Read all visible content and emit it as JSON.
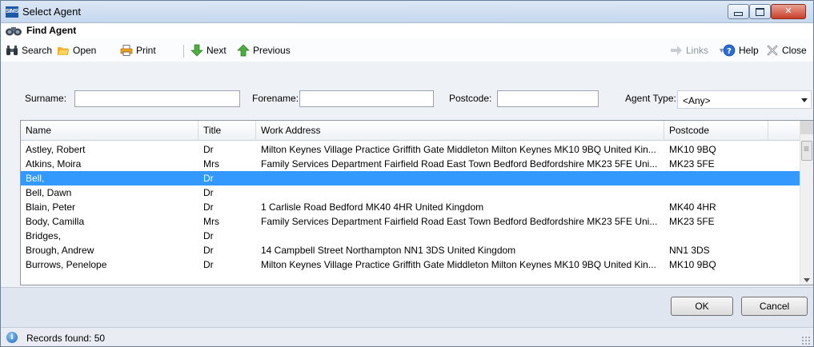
{
  "window": {
    "title": "Select Agent",
    "app_logo": "SIMS"
  },
  "header": {
    "title": "Find Agent",
    "icon": "binoculars-icon"
  },
  "toolbar": {
    "search": "Search",
    "open": "Open",
    "print": "Print",
    "next": "Next",
    "previous": "Previous",
    "links": "Links",
    "help": "Help",
    "close": "Close"
  },
  "search": {
    "surname_label": "Surname:",
    "surname_value": "",
    "forename_label": "Forename:",
    "forename_value": "",
    "postcode_label": "Postcode:",
    "postcode_value": "",
    "agent_type_label": "Agent Type:",
    "agent_type_value": "<Any>"
  },
  "grid": {
    "columns": [
      "Name",
      "Title",
      "Work Address",
      "Postcode"
    ],
    "rows": [
      {
        "name": "Astley, Robert",
        "title": "Dr",
        "address": "Milton Keynes Village Practice Griffith Gate Middleton Milton Keynes MK10 9BQ United Kin...",
        "postcode": "MK10 9BQ"
      },
      {
        "name": "Atkins, Moira",
        "title": "Mrs",
        "address": "Family Services Department Fairfield Road East Town Bedford Bedfordshire MK23 5FE Uni...",
        "postcode": "MK23 5FE"
      },
      {
        "name": "Bell,",
        "title": "Dr",
        "address": "",
        "postcode": ""
      },
      {
        "name": "Bell, Dawn",
        "title": "Dr",
        "address": "",
        "postcode": ""
      },
      {
        "name": "Blain, Peter",
        "title": "Dr",
        "address": "1 Carlisle Road Bedford MK40 4HR United Kingdom",
        "postcode": "MK40 4HR"
      },
      {
        "name": "Body, Camilla",
        "title": "Mrs",
        "address": "Family Services Department Fairfield Road East Town Bedford Bedfordshire MK23 5FE Uni...",
        "postcode": "MK23 5FE"
      },
      {
        "name": "Bridges,",
        "title": "Dr",
        "address": "",
        "postcode": ""
      },
      {
        "name": "Brough, Andrew",
        "title": "Dr",
        "address": "14 Campbell Street Northampton NN1 3DS United Kingdom",
        "postcode": "NN1 3DS"
      },
      {
        "name": "Burrows, Penelope",
        "title": "Dr",
        "address": "Milton Keynes Village Practice Griffith Gate Middleton Milton Keynes MK10 9BQ United Kin...",
        "postcode": "MK10 9BQ"
      }
    ],
    "selected_row": 2
  },
  "buttons": {
    "ok": "OK",
    "cancel": "Cancel"
  },
  "status": {
    "text": "Records found: 50"
  },
  "colors": {
    "selection": "#3399ff",
    "title_bar": "#c6d8ee",
    "close_button": "#c8402a"
  }
}
